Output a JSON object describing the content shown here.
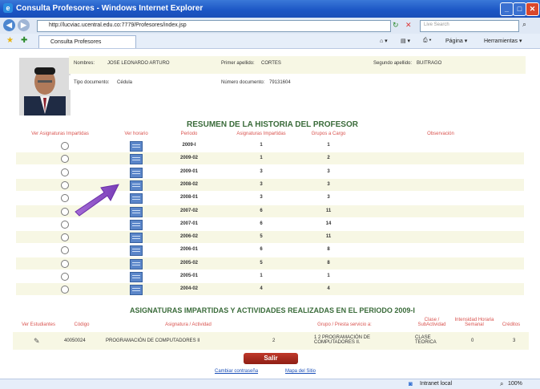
{
  "window": {
    "title": "Consulta Profesores - Windows Internet Explorer"
  },
  "address": {
    "url": "http://lucviac.ucentral.edu.co:7779/Profesores/index.jsp",
    "search_placeholder": "Live Search"
  },
  "tab": {
    "label": "Consulta Profesores"
  },
  "toolbar": {
    "page": "Página",
    "tools": "Herramientas"
  },
  "profile": {
    "nombres_label": "Nombres:",
    "nombres": "JOSE LEONARDO ARTURO",
    "primer_label": "Primer apellido:",
    "primer": "CORTES",
    "segundo_label": "Segundo apellido:",
    "segundo": "BUITRAGO",
    "tipo_label": "Tipo documento:",
    "tipo": "Cédula",
    "numero_label": "Número documento:",
    "numero": "79131604"
  },
  "history": {
    "title": "RESUMEN DE LA HISTORIA DEL PROFESOR",
    "headers": [
      "Ver Asignaturas Impartidas",
      "Ver horario",
      "Periodo",
      "Asignaturas Impartidas",
      "Grupos a Cargo",
      "Observación"
    ],
    "rows": [
      {
        "periodo": "2009-I",
        "asign": "1",
        "grupos": "1"
      },
      {
        "periodo": "2009-02",
        "asign": "1",
        "grupos": "2"
      },
      {
        "periodo": "2009-01",
        "asign": "3",
        "grupos": "3"
      },
      {
        "periodo": "2008-02",
        "asign": "3",
        "grupos": "3"
      },
      {
        "periodo": "2008-01",
        "asign": "3",
        "grupos": "3"
      },
      {
        "periodo": "2007-02",
        "asign": "6",
        "grupos": "11"
      },
      {
        "periodo": "2007-01",
        "asign": "6",
        "grupos": "14"
      },
      {
        "periodo": "2006-02",
        "asign": "5",
        "grupos": "11"
      },
      {
        "periodo": "2006-01",
        "asign": "6",
        "grupos": "8"
      },
      {
        "periodo": "2005-02",
        "asign": "5",
        "grupos": "8"
      },
      {
        "periodo": "2005-01",
        "asign": "1",
        "grupos": "1"
      },
      {
        "periodo": "2004-02",
        "asign": "4",
        "grupos": "4"
      }
    ]
  },
  "subjects": {
    "title": "ASIGNATURAS IMPARTIDAS Y ACTIVIDADES REALIZADAS EN EL PERIODO 2009-I",
    "headers": [
      "Ver Estudiantes",
      "Código",
      "Asignatura / Actividad",
      "Grupo / Presta servicio a:",
      "Clase / SubActividad",
      "Intensidad Horaria Semanal",
      "Créditos"
    ],
    "row": {
      "codigo": "40050024",
      "asignatura": "PROGRAMACIÓN DE COMPUTADORES II",
      "num": "2",
      "grupo": "1 2 PROGRAMACIÓN DE COMPUTADORES II.",
      "clase": "CLASE TEORICA",
      "intensidad": "0",
      "creditos": "3"
    }
  },
  "buttons": {
    "salir": "Salir"
  },
  "links": {
    "cambiar": "Cambiar contraseña",
    "mapa": "Mapa del Sitio"
  },
  "status": {
    "zone": "Intranet local",
    "zoom": "100%"
  }
}
